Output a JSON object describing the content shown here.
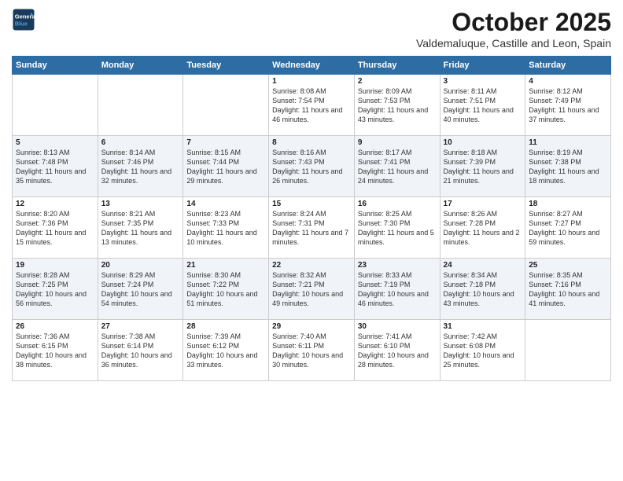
{
  "logo": {
    "line1": "General",
    "line2": "Blue"
  },
  "title": "October 2025",
  "subtitle": "Valdemaluque, Castille and Leon, Spain",
  "days_header": [
    "Sunday",
    "Monday",
    "Tuesday",
    "Wednesday",
    "Thursday",
    "Friday",
    "Saturday"
  ],
  "weeks": [
    [
      {
        "num": "",
        "content": ""
      },
      {
        "num": "",
        "content": ""
      },
      {
        "num": "",
        "content": ""
      },
      {
        "num": "1",
        "content": "Sunrise: 8:08 AM\nSunset: 7:54 PM\nDaylight: 11 hours and 46 minutes."
      },
      {
        "num": "2",
        "content": "Sunrise: 8:09 AM\nSunset: 7:53 PM\nDaylight: 11 hours and 43 minutes."
      },
      {
        "num": "3",
        "content": "Sunrise: 8:11 AM\nSunset: 7:51 PM\nDaylight: 11 hours and 40 minutes."
      },
      {
        "num": "4",
        "content": "Sunrise: 8:12 AM\nSunset: 7:49 PM\nDaylight: 11 hours and 37 minutes."
      }
    ],
    [
      {
        "num": "5",
        "content": "Sunrise: 8:13 AM\nSunset: 7:48 PM\nDaylight: 11 hours and 35 minutes."
      },
      {
        "num": "6",
        "content": "Sunrise: 8:14 AM\nSunset: 7:46 PM\nDaylight: 11 hours and 32 minutes."
      },
      {
        "num": "7",
        "content": "Sunrise: 8:15 AM\nSunset: 7:44 PM\nDaylight: 11 hours and 29 minutes."
      },
      {
        "num": "8",
        "content": "Sunrise: 8:16 AM\nSunset: 7:43 PM\nDaylight: 11 hours and 26 minutes."
      },
      {
        "num": "9",
        "content": "Sunrise: 8:17 AM\nSunset: 7:41 PM\nDaylight: 11 hours and 24 minutes."
      },
      {
        "num": "10",
        "content": "Sunrise: 8:18 AM\nSunset: 7:39 PM\nDaylight: 11 hours and 21 minutes."
      },
      {
        "num": "11",
        "content": "Sunrise: 8:19 AM\nSunset: 7:38 PM\nDaylight: 11 hours and 18 minutes."
      }
    ],
    [
      {
        "num": "12",
        "content": "Sunrise: 8:20 AM\nSunset: 7:36 PM\nDaylight: 11 hours and 15 minutes."
      },
      {
        "num": "13",
        "content": "Sunrise: 8:21 AM\nSunset: 7:35 PM\nDaylight: 11 hours and 13 minutes."
      },
      {
        "num": "14",
        "content": "Sunrise: 8:23 AM\nSunset: 7:33 PM\nDaylight: 11 hours and 10 minutes."
      },
      {
        "num": "15",
        "content": "Sunrise: 8:24 AM\nSunset: 7:31 PM\nDaylight: 11 hours and 7 minutes."
      },
      {
        "num": "16",
        "content": "Sunrise: 8:25 AM\nSunset: 7:30 PM\nDaylight: 11 hours and 5 minutes."
      },
      {
        "num": "17",
        "content": "Sunrise: 8:26 AM\nSunset: 7:28 PM\nDaylight: 11 hours and 2 minutes."
      },
      {
        "num": "18",
        "content": "Sunrise: 8:27 AM\nSunset: 7:27 PM\nDaylight: 10 hours and 59 minutes."
      }
    ],
    [
      {
        "num": "19",
        "content": "Sunrise: 8:28 AM\nSunset: 7:25 PM\nDaylight: 10 hours and 56 minutes."
      },
      {
        "num": "20",
        "content": "Sunrise: 8:29 AM\nSunset: 7:24 PM\nDaylight: 10 hours and 54 minutes."
      },
      {
        "num": "21",
        "content": "Sunrise: 8:30 AM\nSunset: 7:22 PM\nDaylight: 10 hours and 51 minutes."
      },
      {
        "num": "22",
        "content": "Sunrise: 8:32 AM\nSunset: 7:21 PM\nDaylight: 10 hours and 49 minutes."
      },
      {
        "num": "23",
        "content": "Sunrise: 8:33 AM\nSunset: 7:19 PM\nDaylight: 10 hours and 46 minutes."
      },
      {
        "num": "24",
        "content": "Sunrise: 8:34 AM\nSunset: 7:18 PM\nDaylight: 10 hours and 43 minutes."
      },
      {
        "num": "25",
        "content": "Sunrise: 8:35 AM\nSunset: 7:16 PM\nDaylight: 10 hours and 41 minutes."
      }
    ],
    [
      {
        "num": "26",
        "content": "Sunrise: 7:36 AM\nSunset: 6:15 PM\nDaylight: 10 hours and 38 minutes."
      },
      {
        "num": "27",
        "content": "Sunrise: 7:38 AM\nSunset: 6:14 PM\nDaylight: 10 hours and 36 minutes."
      },
      {
        "num": "28",
        "content": "Sunrise: 7:39 AM\nSunset: 6:12 PM\nDaylight: 10 hours and 33 minutes."
      },
      {
        "num": "29",
        "content": "Sunrise: 7:40 AM\nSunset: 6:11 PM\nDaylight: 10 hours and 30 minutes."
      },
      {
        "num": "30",
        "content": "Sunrise: 7:41 AM\nSunset: 6:10 PM\nDaylight: 10 hours and 28 minutes."
      },
      {
        "num": "31",
        "content": "Sunrise: 7:42 AM\nSunset: 6:08 PM\nDaylight: 10 hours and 25 minutes."
      },
      {
        "num": "",
        "content": ""
      }
    ]
  ]
}
